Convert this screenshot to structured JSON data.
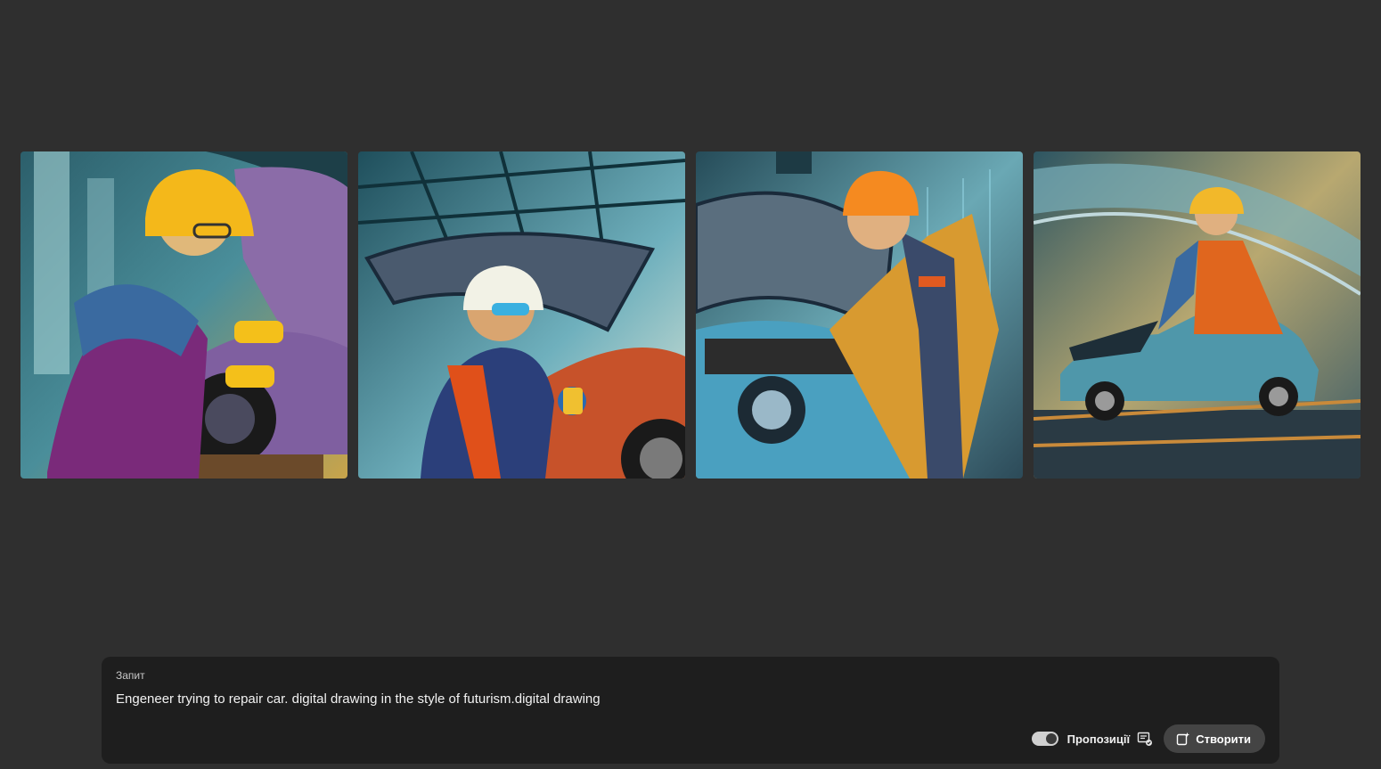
{
  "gallery": {
    "images": [
      {
        "alt": "Engineer with yellow helmet and glasses repairing a purple car"
      },
      {
        "alt": "Engineer with goggles repairing an orange car under open hood"
      },
      {
        "alt": "Engineer in orange helmet working on blue car engine"
      },
      {
        "alt": "Engineer leaning over a blue car in a futuristic hangar"
      }
    ]
  },
  "prompt": {
    "label": "Запит",
    "value": "Engeneer trying to repair car. digital drawing in the style of futurism.digital drawing"
  },
  "controls": {
    "suggestions_label": "Пропозиції",
    "suggestions_enabled": true,
    "generate_label": "Створити"
  },
  "colors": {
    "background": "#2f2f2f",
    "panel": "#1e1e1e",
    "button": "#444444"
  },
  "icons": {
    "suggestions": "suggestions-settings-icon",
    "generate": "generate-sparkle-icon"
  }
}
